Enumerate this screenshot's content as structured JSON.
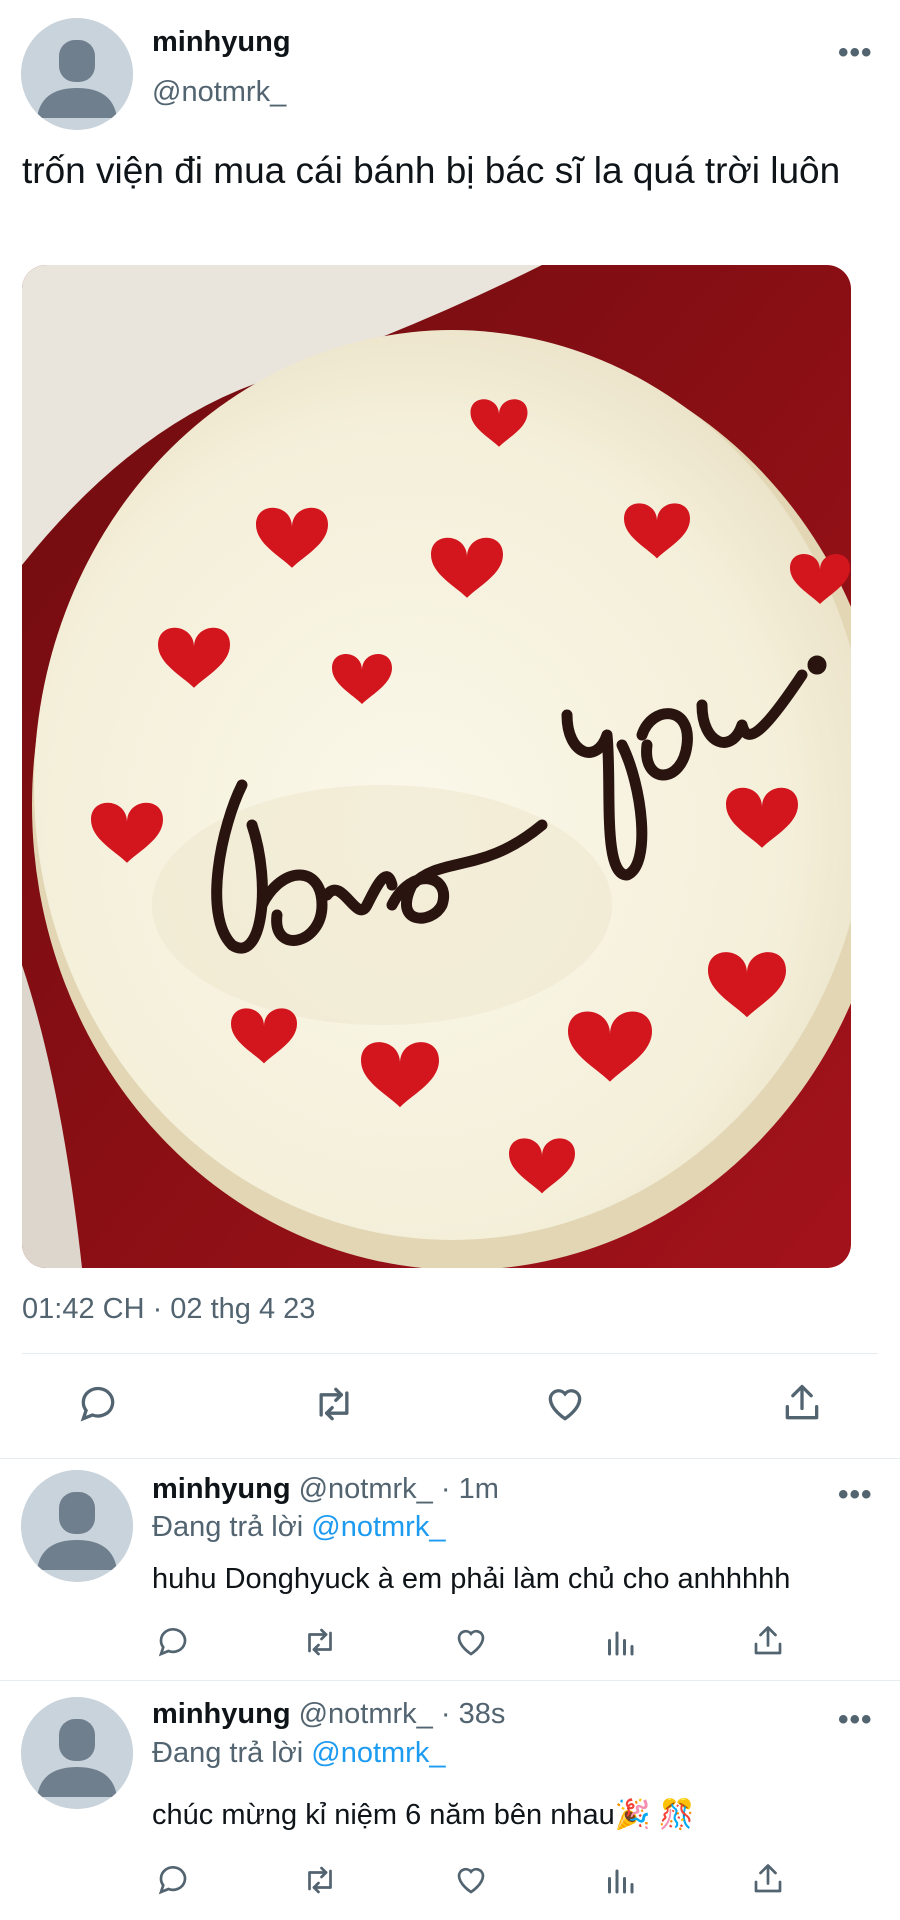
{
  "main_tweet": {
    "display_name": "minhyung",
    "handle": "@notmrk_",
    "text": "trốn viện đi mua cái bánh bị bác sĩ la quá trời luôn",
    "image_caption_on_cake": "love you.",
    "timestamp": "01:42 CH · 02 thg 4 23"
  },
  "replies": [
    {
      "display_name": "minhyung",
      "handle": "@notmrk_",
      "age": "· 1m",
      "replying_prefix": "Đang trả lời",
      "replying_to": "@notmrk_",
      "text": "huhu Donghyuck à em phải làm chủ cho anhhhhh"
    },
    {
      "display_name": "minhyung",
      "handle": "@notmrk_",
      "age": "· 38s",
      "replying_prefix": "Đang trả lời",
      "replying_to": "@notmrk_",
      "text": "chúc mừng kỉ niệm 6 năm bên nhau",
      "emojis": [
        "🎉",
        "🎊"
      ]
    }
  ],
  "more_label": "•••",
  "colors": {
    "accent": "#1d9bf0",
    "text_primary": "#0f1419",
    "text_secondary": "#536471",
    "divider": "#e6ecf0",
    "heart_red": "#d3151e",
    "frosting": "#f4efd9"
  },
  "icons": [
    "reply-icon",
    "retweet-icon",
    "like-icon",
    "views-icon",
    "share-icon",
    "more-icon",
    "avatar-placeholder"
  ]
}
